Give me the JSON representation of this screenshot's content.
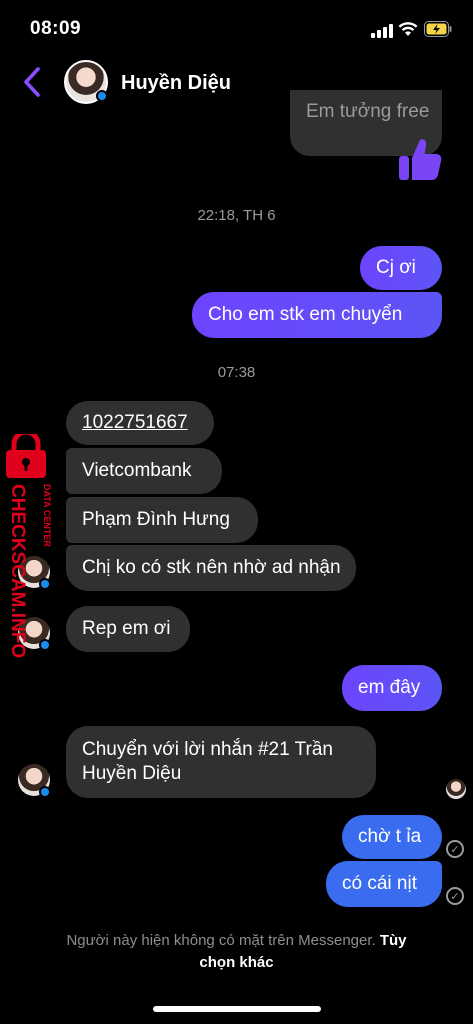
{
  "status": {
    "time": "08:09"
  },
  "header": {
    "contact_name": "Huyền Diệu"
  },
  "messages": {
    "partial_top": "Em tưởng free",
    "ts1": "22:18, TH 6",
    "out1": "Cj ơi",
    "out2": "Cho em stk em chuyển",
    "ts2": "07:38",
    "in1": "1022751667",
    "in2": "Vietcombank",
    "in3": "Phạm Đình Hưng",
    "in4": "Chị ko có stk nên nhờ ad nhận",
    "in5": "Rep em ơi",
    "out3": "em đây",
    "in6_line1": "Chuyển với lời nhắn #21 Trần",
    "in6_line2": "Huyền Diệu",
    "out4": "chờ t ỉa",
    "out5": "có cái nịt"
  },
  "footer": {
    "notice": "Người này hiện không có mặt trên Messenger.",
    "action1": "Tùy",
    "action2": "chọn khác"
  },
  "watermark": {
    "line1": "DATA CENTER",
    "line2": "CHECKSCAM.INFO"
  },
  "colors": {
    "accent": "#6e44ff",
    "blue_bubble": "#3a6cf0",
    "incoming": "#303030",
    "watermark": "#e0001b"
  }
}
